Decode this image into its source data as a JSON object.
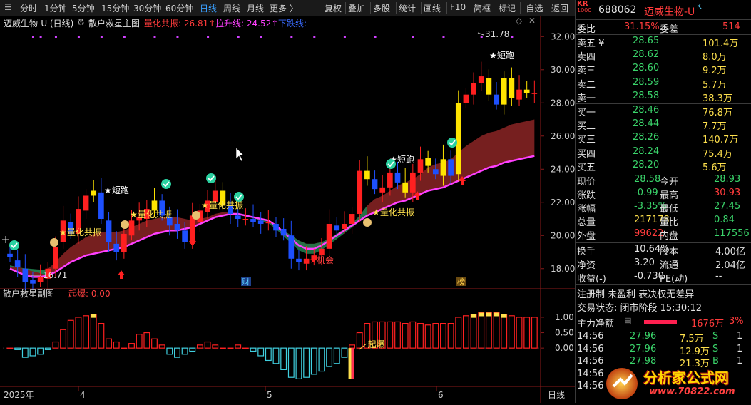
{
  "toolbar": {
    "periods": [
      "分时",
      "1分钟",
      "5分钟",
      "15分钟",
      "30分钟",
      "60分钟",
      "日线",
      "周线",
      "月线",
      "更多 〉"
    ],
    "active_period": "日线",
    "tools": [
      "复权",
      "叠加",
      "多股",
      "统计",
      "画线",
      "F10",
      "简框",
      "标记",
      "-自选",
      "返回"
    ]
  },
  "main_chart": {
    "stock_label": "迈威生物-U (日线)",
    "indicator_name": "散户救星主图",
    "ind1_label": "量化共振: 26.81↑",
    "ind2_label": "拉升线: 24.52↑",
    "ind3_label": "下跌线: -",
    "colors": {
      "up": "#ff2020",
      "down": "#1e50ff",
      "yellow": "#ffe400",
      "fill": "#8b2424",
      "magenta": "#ff40ff",
      "green": "#1f7a4a"
    },
    "price_ticks": [
      "32.00",
      "30.00",
      "28.00",
      "26.00",
      "24.00",
      "22.00",
      "20.00",
      "18.00"
    ],
    "annotations": {
      "high": "31.78",
      "low": "16.71",
      "gonz": "量化共振",
      "duan": "短跑",
      "jihui": "机会",
      "cai": "财",
      "bang": "榜"
    }
  },
  "chart_data": {
    "type": "candlestick",
    "title": "迈威生物-U (日线)",
    "ylim": [
      17,
      32.4
    ],
    "x": [
      1,
      2,
      3,
      4,
      5,
      6,
      7,
      8,
      9,
      10,
      11,
      12,
      13,
      14,
      15,
      16,
      17,
      18,
      19,
      20,
      21,
      22,
      23,
      24,
      25,
      26,
      27,
      28,
      29,
      30,
      31,
      32,
      33,
      34,
      35,
      36,
      37,
      38,
      39,
      40,
      41,
      42,
      43,
      44,
      45,
      46,
      47,
      48,
      49,
      50,
      51,
      52,
      53,
      54,
      55,
      56,
      57,
      58,
      59,
      60,
      61,
      62,
      63,
      64,
      65,
      66,
      67,
      68,
      69,
      70
    ],
    "open": [
      18.9,
      18.5,
      18.0,
      17.3,
      17.2,
      17.4,
      18.0,
      19.6,
      20.8,
      20.1,
      21.5,
      22.4,
      22.6,
      20.9,
      19.5,
      19.0,
      20.0,
      20.9,
      21.0,
      21.5,
      22.1,
      21.1,
      20.7,
      20.3,
      19.5,
      20.8,
      21.4,
      22.0,
      22.7,
      21.8,
      21.2,
      21.0,
      21.0,
      20.9,
      20.8,
      20.7,
      20.4,
      20.0,
      18.6,
      18.3,
      18.5,
      18.8,
      19.2,
      20.6,
      20.4,
      20.7,
      21.3,
      23.9,
      23.4,
      22.6,
      22.9,
      23.8,
      23.2,
      22.6,
      23.8,
      24.7,
      24.0,
      23.6,
      24.6,
      23.7,
      28.0,
      28.5,
      29.2,
      29.5,
      28.5,
      27.9,
      29.5,
      28.2,
      28.8,
      28.6
    ],
    "close": [
      18.7,
      18.1,
      17.2,
      17.1,
      17.5,
      18.0,
      19.3,
      20.9,
      20.1,
      21.6,
      22.4,
      22.7,
      21.0,
      19.6,
      19.0,
      20.1,
      20.9,
      21.1,
      21.6,
      22.1,
      21.2,
      20.6,
      20.3,
      19.6,
      21.2,
      21.5,
      22.1,
      22.7,
      21.8,
      21.3,
      21.0,
      21.0,
      20.8,
      20.7,
      20.8,
      20.3,
      20.0,
      18.6,
      18.4,
      18.6,
      18.8,
      19.2,
      20.7,
      20.3,
      20.7,
      21.3,
      23.9,
      23.4,
      22.8,
      22.9,
      23.8,
      23.2,
      22.6,
      23.8,
      24.6,
      24.2,
      23.7,
      24.6,
      23.6,
      28.0,
      28.5,
      29.2,
      29.6,
      28.5,
      27.9,
      29.5,
      28.3,
      28.8,
      28.6,
      28.6
    ],
    "ma_upper": [
      18.2,
      18.1,
      18.0,
      17.9,
      17.9,
      18.0,
      18.4,
      18.9,
      19.3,
      19.6,
      19.9,
      20.1,
      20.2,
      20.2,
      20.2,
      20.3,
      20.5,
      20.7,
      20.9,
      21.0,
      21.1,
      21.1,
      21.1,
      21.0,
      20.9,
      21.0,
      21.1,
      21.3,
      21.4,
      21.4,
      21.3,
      21.2,
      21.1,
      21.0,
      20.8,
      20.6,
      20.3,
      20.0,
      19.7,
      19.5,
      19.5,
      19.6,
      19.8,
      20.1,
      20.4,
      20.7,
      21.2,
      21.8,
      22.2,
      22.4,
      22.7,
      23.0,
      23.2,
      23.4,
      23.7,
      24.1,
      24.3,
      24.4,
      24.6,
      25.0,
      25.4,
      25.7,
      26.0,
      26.2,
      26.3,
      26.5,
      26.7,
      26.8,
      26.9,
      27.0
    ],
    "ma_lower": [
      18.0,
      17.8,
      17.6,
      17.5,
      17.5,
      17.6,
      17.8,
      18.1,
      18.4,
      18.6,
      18.8,
      18.9,
      19.0,
      19.1,
      19.2,
      19.3,
      19.5,
      19.7,
      19.9,
      20.1,
      20.2,
      20.3,
      20.3,
      20.4,
      20.5,
      20.7,
      20.9,
      21.1,
      21.2,
      21.3,
      21.3,
      21.2,
      21.1,
      21.0,
      20.9,
      20.6,
      20.2,
      19.8,
      19.4,
      19.2,
      19.2,
      19.4,
      19.7,
      20.0,
      20.3,
      20.6,
      20.9,
      21.2,
      21.4,
      21.6,
      21.8,
      22.0,
      22.1,
      22.3,
      22.5,
      22.7,
      22.8,
      22.9,
      23.1,
      23.3,
      23.5,
      23.7,
      23.9,
      24.1,
      24.2,
      24.4,
      24.5,
      24.6,
      24.7,
      24.8
    ],
    "sub_values": [
      0.0,
      -0.05,
      -0.3,
      -0.25,
      -0.2,
      -0.05,
      0.2,
      0.6,
      0.9,
      1.0,
      1.05,
      1.1,
      0.8,
      0.3,
      0.2,
      0.0,
      0.15,
      0.45,
      0.5,
      0.3,
      0.1,
      -0.2,
      -0.3,
      -0.2,
      -0.1,
      0.1,
      0.2,
      0.1,
      0.0,
      0.0,
      0.1,
      0.0,
      -0.1,
      -0.25,
      -0.4,
      -0.5,
      -0.7,
      -0.95,
      -1.0,
      -0.95,
      -0.85,
      -0.75,
      -0.6,
      -0.5,
      -0.3,
      0.1,
      0.5,
      0.8,
      0.85,
      0.85,
      0.85,
      0.85,
      0.8,
      0.85,
      0.8,
      0.75,
      0.8,
      0.8,
      0.8,
      1.0,
      1.05,
      1.1,
      1.15,
      1.15,
      1.15,
      1.1,
      1.05,
      1.0,
      1.0,
      1.0
    ],
    "sub_ylim": [
      -1.2,
      1.3
    ]
  },
  "sub_chart": {
    "name": "散户救星副图",
    "label": "起爆: 0.00",
    "ticks": [
      "1.00",
      "0.50",
      "0.00"
    ],
    "qibao": "起爆"
  },
  "x_axis": {
    "year": "2025年",
    "m4": "4",
    "m5": "5",
    "m6": "6",
    "period_label": "日线"
  },
  "quote": {
    "code": "688062",
    "name": "迈威生物-U",
    "tag": "KR",
    "tag2": "1000",
    "weibi_label": "委比",
    "weibi": "31.15%",
    "weicha_label": "委差",
    "weicha": "514",
    "asks": [
      {
        "label": "卖五 ¥",
        "price": "28.65",
        "vol": "101.4万"
      },
      {
        "label": "卖四",
        "price": "28.62",
        "vol": "8.0万"
      },
      {
        "label": "卖三",
        "price": "28.60",
        "vol": "9.2万"
      },
      {
        "label": "卖二",
        "price": "28.59",
        "vol": "5.7万"
      },
      {
        "label": "卖一",
        "price": "28.58",
        "vol": "38.3万"
      }
    ],
    "bids": [
      {
        "label": "买一",
        "price": "28.46",
        "vol": "76.8万"
      },
      {
        "label": "买二",
        "price": "28.44",
        "vol": "7.7万"
      },
      {
        "label": "买三",
        "price": "28.26",
        "vol": "140.7万"
      },
      {
        "label": "买四",
        "price": "28.24",
        "vol": "75.4万"
      },
      {
        "label": "买五",
        "price": "28.20",
        "vol": "5.6万"
      }
    ],
    "stats": [
      {
        "l1": "现价",
        "v1": "28.58",
        "l2": "今开",
        "v2": "28.93"
      },
      {
        "l1": "涨跌",
        "v1": "-0.99",
        "l2": "最高",
        "v2": "30.93"
      },
      {
        "l1": "涨幅",
        "v1": "-3.35%",
        "l2": "最低",
        "v2": "27.45"
      },
      {
        "l1": "总量",
        "v1": "217178",
        "l2": "量比",
        "v2": "0.84"
      },
      {
        "l1": "外盘",
        "v1": "99622",
        "l2": "内盘",
        "v2": "117556"
      }
    ],
    "stats2": [
      {
        "l1": "换手",
        "v1": "10.64%",
        "l2": "股本",
        "v2": "4.00亿"
      },
      {
        "l1": "净资",
        "v1": "3.20",
        "l2": "流通",
        "v2": "2.04亿"
      },
      {
        "l1": "收益(-)",
        "v1": "-0.730",
        "l2": "PE(动)",
        "v2": "--"
      }
    ],
    "info1": "注册制 未盈利 表决权无差异",
    "info2": "交易状态: 闭市阶段 15:30:12",
    "flow_label": "主力净额",
    "flow_value": "1676万",
    "flow_pct": "3%",
    "ticks": [
      {
        "t": "14:56",
        "p": "27.96",
        "v": "7.5万",
        "s": "S",
        "n": "1"
      },
      {
        "t": "14:56",
        "p": "27.96",
        "v": "12.9万",
        "s": "S",
        "n": "1"
      },
      {
        "t": "14:56",
        "p": "27.98",
        "v": "21.3万",
        "s": "B",
        "n": "1"
      },
      {
        "t": "14:56",
        "p": "",
        "v": "",
        "s": "",
        "n": ""
      },
      {
        "t": "14:56",
        "p": "",
        "v": "",
        "s": "",
        "n": ""
      }
    ]
  },
  "watermark": {
    "text": "分析家公式网",
    "url": "www.70822.com"
  }
}
